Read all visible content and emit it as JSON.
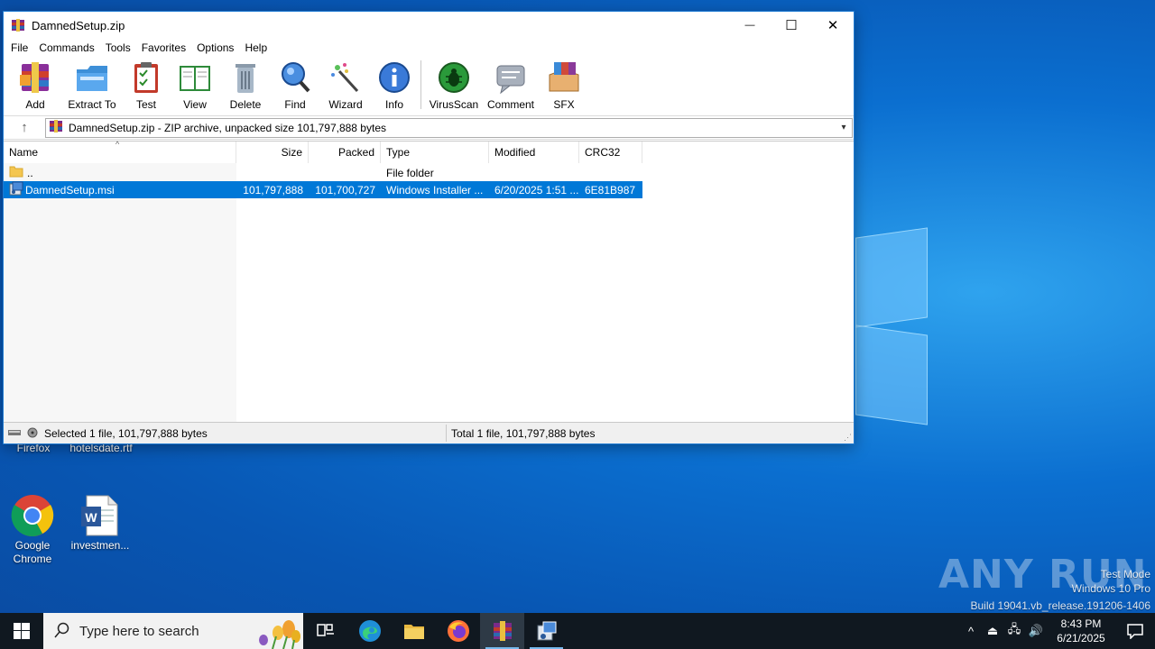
{
  "window": {
    "title": "DamnedSetup.zip",
    "controls": {
      "minimize": "—",
      "maximize": "☐",
      "close": "✕"
    }
  },
  "menu": [
    "File",
    "Commands",
    "Tools",
    "Favorites",
    "Options",
    "Help"
  ],
  "toolbar": [
    {
      "label": "Add",
      "icon": "add-archive-icon"
    },
    {
      "label": "Extract To",
      "icon": "extract-folder-icon"
    },
    {
      "label": "Test",
      "icon": "test-clipboard-icon"
    },
    {
      "label": "View",
      "icon": "view-book-icon"
    },
    {
      "label": "Delete",
      "icon": "trash-icon"
    },
    {
      "label": "Find",
      "icon": "magnifier-icon"
    },
    {
      "label": "Wizard",
      "icon": "wand-icon"
    },
    {
      "label": "Info",
      "icon": "info-icon"
    },
    {
      "label": "VirusScan",
      "icon": "bug-icon"
    },
    {
      "label": "Comment",
      "icon": "comment-icon"
    },
    {
      "label": "SFX",
      "icon": "sfx-box-icon"
    }
  ],
  "address": {
    "path": "DamnedSetup.zip - ZIP archive, unpacked size 101,797,888 bytes"
  },
  "columns": [
    "Name",
    "Size",
    "Packed",
    "Type",
    "Modified",
    "CRC32"
  ],
  "rows": [
    {
      "name": "..",
      "size": "",
      "packed": "",
      "type": "File folder",
      "modified": "",
      "crc": "",
      "selected": false
    },
    {
      "name": "DamnedSetup.msi",
      "size": "101,797,888",
      "packed": "101,700,727",
      "type": "Windows Installer ...",
      "modified": "6/20/2025 1:51 ...",
      "crc": "6E81B987",
      "selected": true
    }
  ],
  "status": {
    "selected": "Selected 1 file, 101,797,888 bytes",
    "total": "Total 1 file, 101,797,888 bytes"
  },
  "desktop": {
    "icons": [
      {
        "label": "Firefox"
      },
      {
        "label": "hotelsdate.rtf"
      },
      {
        "label": "Google\nChrome"
      },
      {
        "label": "investmen..."
      }
    ],
    "watermark": {
      "brand": "ANY RUN",
      "line1": "Test Mode",
      "line2": "Windows 10 Pro",
      "line3": "Build 19041.vb_release.191206-1406"
    }
  },
  "taskbar": {
    "search_placeholder": "Type here to search",
    "time": "8:43 PM",
    "date": "6/21/2025"
  },
  "colors": {
    "selection": "#0078d7",
    "taskbar": "#101820",
    "desktop": "#0b6fd0"
  }
}
